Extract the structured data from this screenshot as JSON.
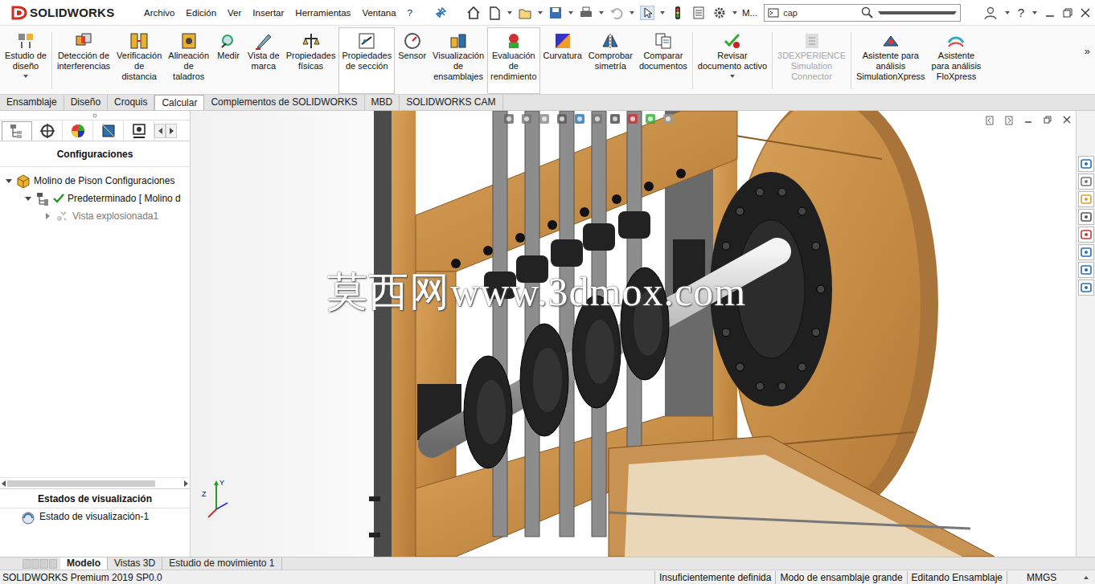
{
  "app": {
    "logo": "SOLIDWORKS"
  },
  "menu": [
    "Archivo",
    "Edición",
    "Ver",
    "Insertar",
    "Herramientas",
    "Ventana",
    "?"
  ],
  "quick_access_more": "M...",
  "search": {
    "value": "cap"
  },
  "help": "?",
  "ribbon": [
    {
      "lines": [
        "Estudio de",
        "diseño"
      ],
      "highlighted": false,
      "disabled": false,
      "dropdown": true
    },
    {
      "lines": [
        "Detección de",
        "interferencias"
      ],
      "highlighted": false,
      "disabled": false,
      "dropdown": false
    },
    {
      "lines": [
        "Verificación",
        "de",
        "distancia"
      ],
      "highlighted": false,
      "disabled": false,
      "dropdown": false
    },
    {
      "lines": [
        "Alineación",
        "de",
        "taladros"
      ],
      "highlighted": false,
      "disabled": false,
      "dropdown": false
    },
    {
      "lines": [
        "Medir"
      ],
      "highlighted": false,
      "disabled": false,
      "dropdown": false
    },
    {
      "lines": [
        "Vista de",
        "marca"
      ],
      "highlighted": false,
      "disabled": false,
      "dropdown": false
    },
    {
      "lines": [
        "Propiedades",
        "físicas"
      ],
      "highlighted": false,
      "disabled": false,
      "dropdown": false
    },
    {
      "lines": [
        "Propiedades",
        "de sección"
      ],
      "highlighted": true,
      "disabled": false,
      "dropdown": false
    },
    {
      "lines": [
        "Sensor"
      ],
      "highlighted": false,
      "disabled": false,
      "dropdown": false
    },
    {
      "lines": [
        "Visualización",
        "de",
        "ensamblajes"
      ],
      "highlighted": false,
      "disabled": false,
      "dropdown": false
    },
    {
      "lines": [
        "Evaluación",
        "de",
        "rendimiento"
      ],
      "highlighted": true,
      "disabled": false,
      "dropdown": false
    },
    {
      "lines": [
        "Curvatura"
      ],
      "highlighted": false,
      "disabled": false,
      "dropdown": false
    },
    {
      "lines": [
        "Comprobar",
        "simetría"
      ],
      "highlighted": false,
      "disabled": false,
      "dropdown": false
    },
    {
      "lines": [
        "Comparar",
        "documentos"
      ],
      "highlighted": false,
      "disabled": false,
      "dropdown": false
    },
    {
      "lines": [
        "Revisar",
        "documento activo"
      ],
      "highlighted": false,
      "disabled": false,
      "dropdown": true
    },
    {
      "lines": [
        "3DEXPERIENCE",
        "Simulation",
        "Connector"
      ],
      "highlighted": false,
      "disabled": true,
      "dropdown": false
    },
    {
      "lines": [
        "Asistente para",
        "análisis",
        "SimulationXpress"
      ],
      "highlighted": false,
      "disabled": false,
      "dropdown": false
    },
    {
      "lines": [
        "Asistente",
        "para análisis",
        "FloXpress"
      ],
      "highlighted": false,
      "disabled": false,
      "dropdown": false
    }
  ],
  "ribbon_more": "»",
  "tabs": [
    {
      "label": "Ensamblaje",
      "selected": false
    },
    {
      "label": "Diseño",
      "selected": false
    },
    {
      "label": "Croquis",
      "selected": false
    },
    {
      "label": "Calcular",
      "selected": true
    },
    {
      "label": "Complementos de SOLIDWORKS",
      "selected": false
    },
    {
      "label": "MBD",
      "selected": false
    },
    {
      "label": "SOLIDWORKS CAM",
      "selected": false
    }
  ],
  "panel": {
    "tabs": [
      {
        "selected": true
      },
      {
        "selected": false
      },
      {
        "selected": false
      },
      {
        "selected": false
      },
      {
        "selected": false
      }
    ],
    "title": "Configuraciones",
    "tree": [
      {
        "label": "Molino de Pison Configuraciones",
        "level": 0,
        "expanded": true,
        "active": false,
        "greyed": false
      },
      {
        "label": "Predeterminado [ Molino d",
        "level": 1,
        "expanded": true,
        "active": true,
        "greyed": false
      },
      {
        "label": "Vista explosionada1",
        "level": 2,
        "expanded": false,
        "active": false,
        "greyed": true
      }
    ],
    "display_states_title": "Estados de visualización",
    "display_states": [
      "Estado de visualización-1"
    ]
  },
  "viewport": {
    "watermark": "莫西网www.3dmox.com",
    "triad": [
      "Z",
      "Y"
    ]
  },
  "bottom_tabs": [
    {
      "label": "Modelo",
      "selected": true
    },
    {
      "label": "Vistas 3D",
      "selected": false
    },
    {
      "label": "Estudio de movimiento 1",
      "selected": false
    }
  ],
  "status_bar": {
    "product": "SOLIDWORKS Premium 2019 SP0.0",
    "segments": [
      "Insuficientemente definida",
      "Modo de ensamblaje grande",
      "Editando Ensamblaje"
    ],
    "units": "MMGS"
  }
}
